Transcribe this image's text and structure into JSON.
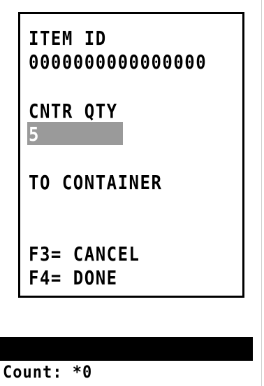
{
  "screen": {
    "item_id_label": "ITEM ID",
    "item_id_value": "0000000000000000",
    "cntr_qty_label": "CNTR QTY",
    "cntr_qty_value": "5",
    "to_container_label": "TO CONTAINER",
    "f3_label": "F3= CANCEL",
    "f4_label": "F4= DONE"
  },
  "footer": {
    "count_text": "Count: *0"
  },
  "colors": {
    "background": "#ffffff",
    "foreground": "#000000",
    "field_highlight": "#9a9a9a",
    "status_bar": "#000000"
  }
}
